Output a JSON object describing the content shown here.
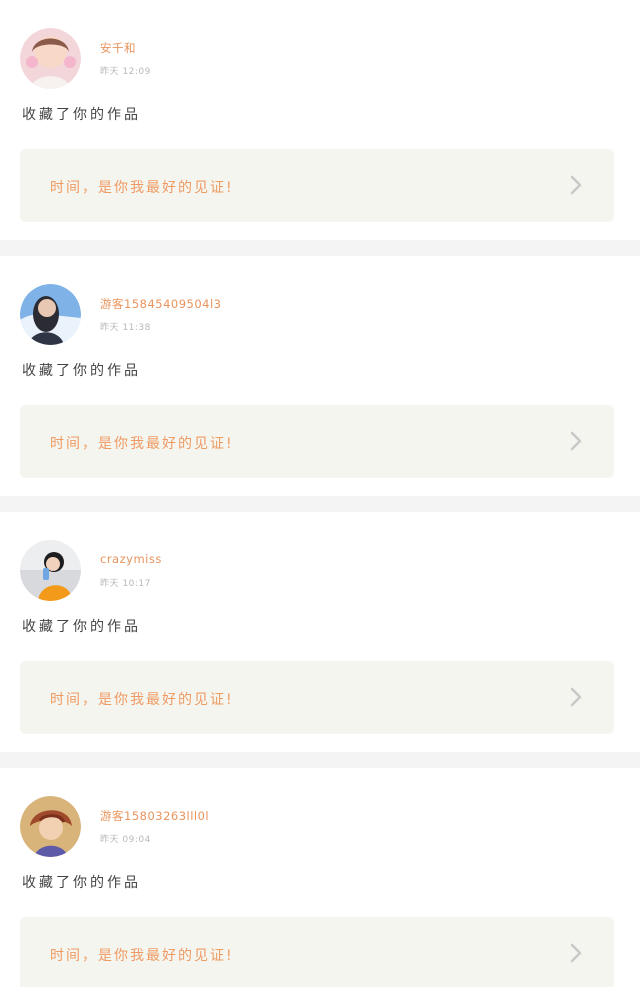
{
  "feed": [
    {
      "name": "安千和",
      "time": "昨天 12:09",
      "action": "收藏了你的作品",
      "work_text": "时间，是你我最好的见证!"
    },
    {
      "name": "游客15845409504l3",
      "time": "昨天 11:38",
      "action": "收藏了你的作品",
      "work_text": "时间，是你我最好的见证!"
    },
    {
      "name": "crazymiss",
      "time": "昨天 10:17",
      "action": "收藏了你的作品",
      "work_text": "时间，是你我最好的见证!"
    },
    {
      "name": "游客15803263lll0l",
      "time": "昨天 09:04",
      "action": "收藏了你的作品",
      "work_text": "时间，是你我最好的见证!"
    }
  ],
  "icons": {
    "chevron": "chevron-right-icon"
  },
  "colors": {
    "tab_indicator": "#e76aa0",
    "accent_text": "#e8945d",
    "card_box": "#f5f5ef",
    "separator": "#f4f4f4"
  }
}
